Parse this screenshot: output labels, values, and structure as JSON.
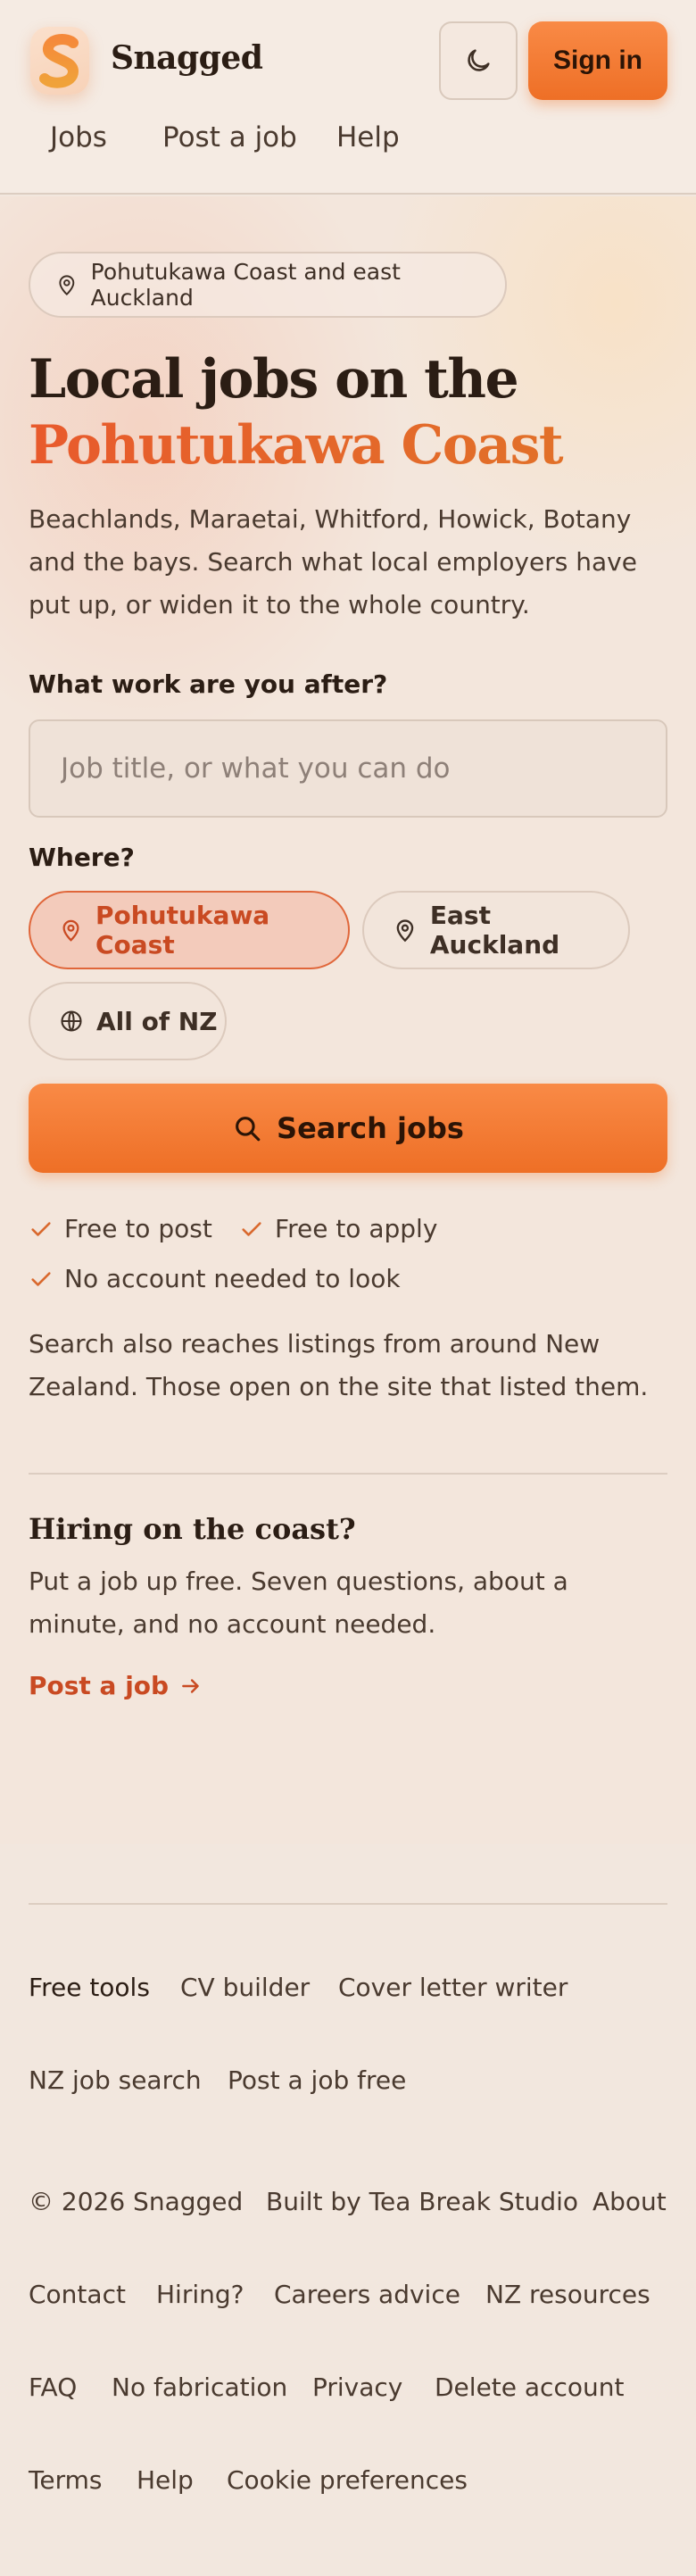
{
  "brand": {
    "name": "Snagged"
  },
  "header": {
    "theme_toggle_icon": "moon-icon",
    "signin_label": "Sign in",
    "nav": [
      "Jobs",
      "Post a job",
      "Help"
    ]
  },
  "hero": {
    "location_pill": "Pohutukawa Coast and east Auckland",
    "title_line1": "Local jobs on the",
    "title_line2": "Pohutukawa Coast",
    "intro": "Beachlands, Maraetai, Whitford, Howick, Botany and the bays. Search what local employers have put up, or widen it to the whole country.",
    "what_label": "What work are you after?",
    "what_placeholder": "Job title, or what you can do",
    "where_label": "Where?",
    "locations": [
      {
        "label": "Pohutukawa Coast",
        "icon": "map-pin-icon",
        "selected": true
      },
      {
        "label": "East Auckland",
        "icon": "map-pin-icon",
        "selected": false
      },
      {
        "label": "All of NZ",
        "icon": "globe-icon",
        "selected": false
      }
    ],
    "search_label": "Search jobs",
    "checks": [
      "Free to post",
      "Free to apply",
      "No account needed to look"
    ],
    "note": "Search also reaches listings from around New Zealand. Those open on the site that listed them."
  },
  "hiring": {
    "title": "Hiring on the coast?",
    "text": "Put a job up free. Seven questions, about a minute, and no account needed.",
    "link": "Post a job"
  },
  "footer": {
    "tools_heading": "Free tools",
    "tools": [
      "CV builder",
      "Cover letter writer",
      "NZ job search",
      "Post a job free"
    ],
    "copyright": "© 2026 Snagged",
    "links": [
      "Built by Tea Break Studio",
      "About",
      "Contact",
      "Hiring?",
      "Careers advice",
      "NZ resources",
      "FAQ",
      "No fabrication",
      "Privacy",
      "Delete account",
      "Terms",
      "Help",
      "Cookie preferences"
    ]
  },
  "colors": {
    "accent": "#ee6f26",
    "accent_text": "#c94a22",
    "background": "#f2e7de"
  }
}
